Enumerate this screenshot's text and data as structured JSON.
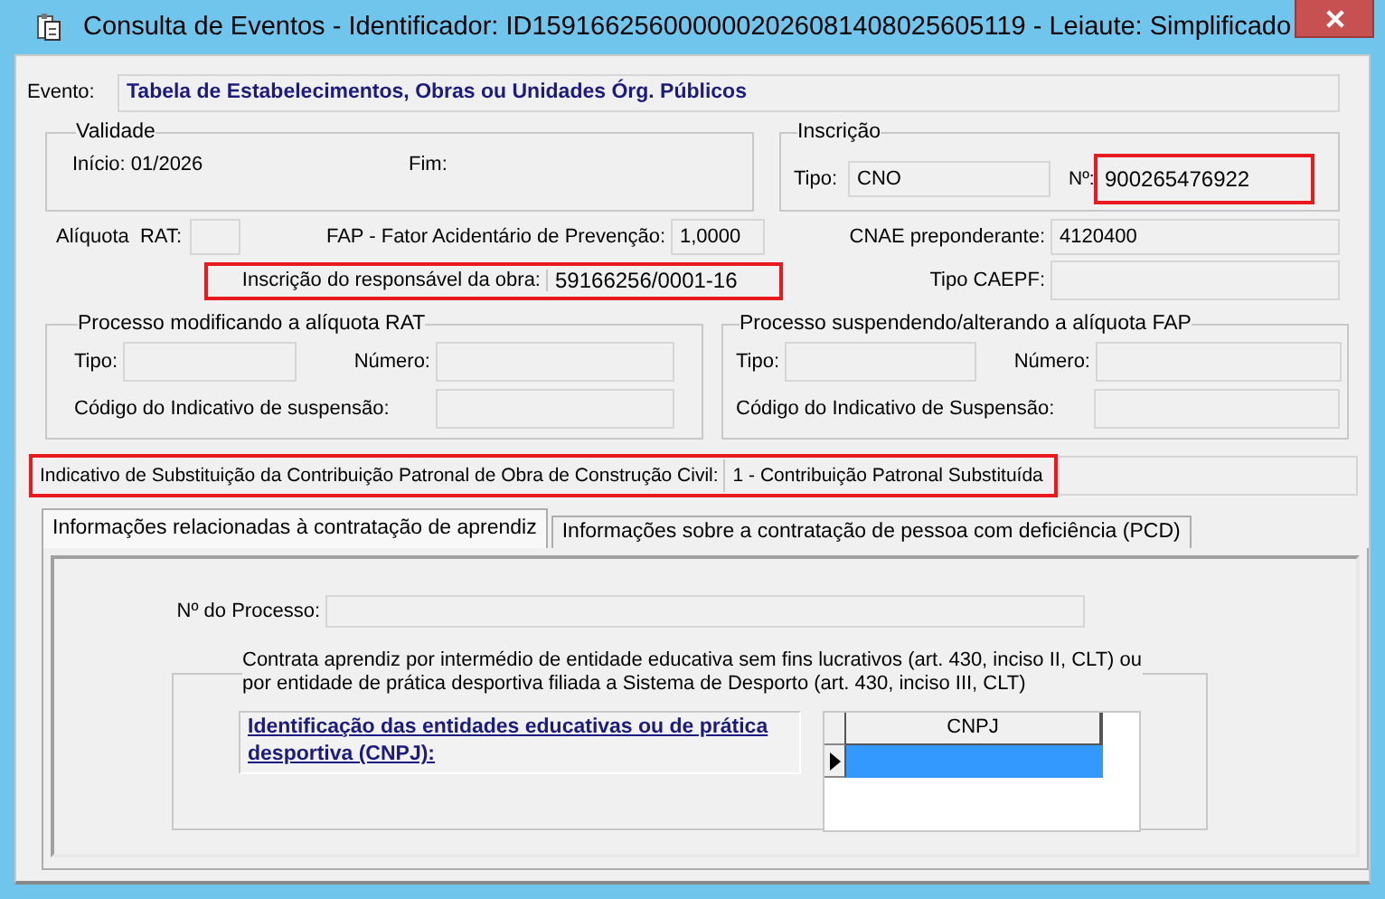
{
  "window": {
    "title": "Consulta de Eventos - Identificador: ID1591662560000002026081408025605119 - Leiaute: Simplificado"
  },
  "evento": {
    "label": "Evento:",
    "value": "Tabela de Estabelecimentos, Obras ou Unidades Órg. Públicos"
  },
  "validade": {
    "title": "Validade",
    "inicio": "Início: 01/2026",
    "fim_label": "Fim:"
  },
  "inscricao": {
    "title": "Inscrição",
    "tipo_label": "Tipo:",
    "tipo": "CNO",
    "numero_label": "Nº:",
    "numero": "900265476922",
    "numero_highlighted": true
  },
  "aliquota_rat": {
    "label": "Alíquota  RAT:"
  },
  "fap": {
    "label": "FAP - Fator Acidentário de Prevenção:",
    "value": "1,0000"
  },
  "cnae": {
    "label": "CNAE preponderante:",
    "value": "4120400"
  },
  "responsavel": {
    "label": "Inscrição do responsável da obra:",
    "value": "59166256/0001-16",
    "highlighted": true
  },
  "tipo_caepf": {
    "label": "Tipo CAEPF:"
  },
  "processo_rat": {
    "title": "Processo modificando a alíquota RAT",
    "tipo_label": "Tipo:",
    "numero_label": "Número:",
    "codigo_label": "Código do Indicativo de suspensão:"
  },
  "processo_fap": {
    "title": "Processo suspendendo/alterando a alíquota FAP",
    "tipo_label": "Tipo:",
    "numero_label": "Número:",
    "codigo_label": "Código do Indicativo de Suspensão:"
  },
  "indicativo": {
    "label": "Indicativo de Substituição da Contribuição Patronal de Obra de Construção Civil:",
    "value": "1 - Contribuição Patronal Substituída",
    "highlighted": true
  },
  "tabs": [
    {
      "label": "Informações relacionadas à contratação de aprendiz",
      "selected": true
    },
    {
      "label": "Informações sobre a contratação de pessoa com deficiência (PCD)",
      "selected": false
    }
  ],
  "aprendiz": {
    "processo_label": "Nº do Processo:",
    "group_title": "Contrata aprendiz por intermédio de entidade educativa sem fins lucrativos (art. 430, inciso II, CLT) ou\npor entidade de prática desportiva filiada a Sistema de Desporto (art. 430, inciso III, CLT)",
    "entidades_label": "Identificação das entidades educativas ou de prática desportiva (CNPJ):",
    "grid": {
      "columns": [
        "CNPJ"
      ],
      "rows": [
        {
          "selected": true
        }
      ]
    }
  }
}
